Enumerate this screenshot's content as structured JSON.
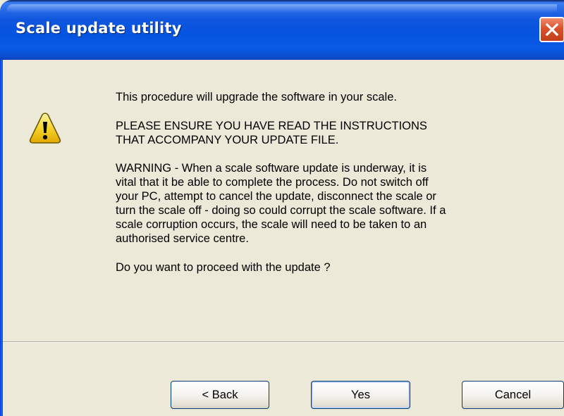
{
  "window": {
    "title": "Scale update utility"
  },
  "titlebar": {
    "close_icon": "close-icon",
    "close_color": "#d9512c"
  },
  "dialog": {
    "icon": "warning-icon",
    "paragraphs": {
      "p1": "This procedure will upgrade the software in your scale.",
      "p2": "PLEASE ENSURE YOU HAVE READ THE INSTRUCTIONS\nTHAT ACCOMPANY YOUR UPDATE FILE.",
      "p3": "WARNING - When a scale software update is underway, it is\nvital that it be able to complete the process. Do not switch off\nyour PC, attempt to cancel the update, disconnect the scale or\nturn the scale off - doing so could corrupt the scale software. If a\nscale corruption occurs, the scale will need to be taken to an\nauthorised service centre.",
      "p4": "Do you want to proceed with the update ?"
    }
  },
  "buttons": {
    "back": "< Back",
    "yes": "Yes",
    "cancel": "Cancel"
  },
  "colors": {
    "titlebar_blue": "#0554e0",
    "dialog_background": "#ece9d8",
    "warning_yellow": "#f6d32d"
  }
}
